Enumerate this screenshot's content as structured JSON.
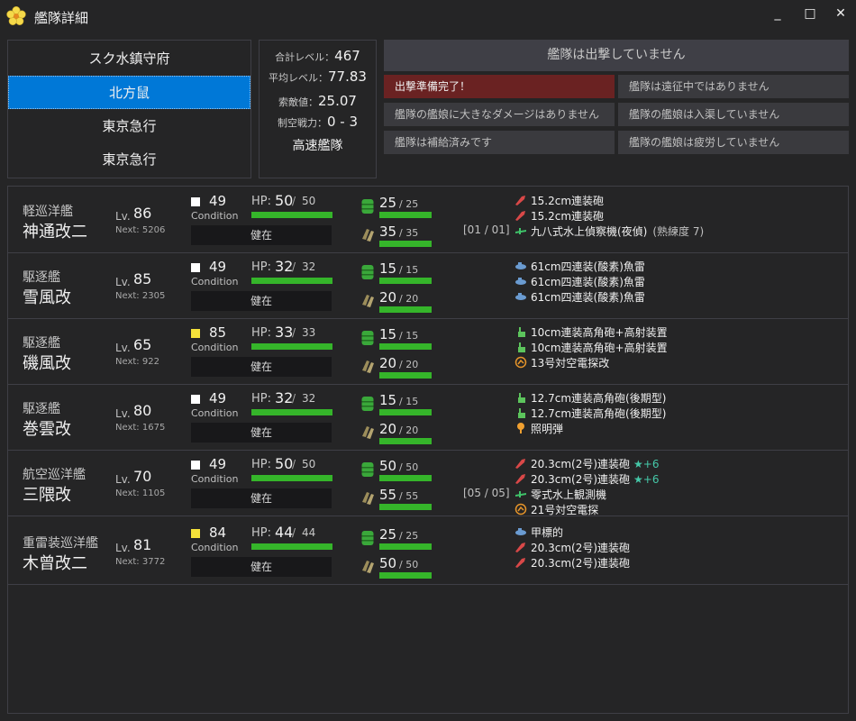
{
  "window": {
    "title": "艦隊詳細",
    "controls": [
      "_",
      "□",
      "✕"
    ]
  },
  "fleets": [
    {
      "label": "スク水鎮守府",
      "selected": false
    },
    {
      "label": "北方鼠",
      "selected": true
    },
    {
      "label": "東京急行",
      "selected": false
    },
    {
      "label": "東京急行",
      "selected": false
    }
  ],
  "fleet_stats": {
    "total_level_label": "合計レベル：",
    "total_level": "467",
    "avg_level_label": "平均レベル：",
    "avg_level": "77.83",
    "los_label": "索敵値：",
    "los": "25.07",
    "air_label": "制空戦力：",
    "air": "0 - 3",
    "speed": "高速艦隊"
  },
  "status": {
    "main": "艦隊は出撃していません",
    "cells": [
      {
        "text": "出撃準備完了！",
        "ready": true
      },
      {
        "text": "艦隊は遠征中ではありません",
        "ready": false
      },
      {
        "text": "艦隊の艦娘に大きなダメージはありません",
        "ready": false
      },
      {
        "text": "艦隊の艦娘は入渠していません",
        "ready": false
      },
      {
        "text": "艦隊は補給済みです",
        "ready": false
      },
      {
        "text": "艦隊の艦娘は疲労していません",
        "ready": false
      }
    ]
  },
  "ships": [
    {
      "type": "軽巡洋艦",
      "name": "神通改二",
      "level": "86",
      "next": "5206",
      "condition": "49",
      "condition_high": false,
      "hp": "50",
      "hp_max": "50",
      "fuel": "25",
      "fuel_max": "25",
      "ammo": "35",
      "ammo_max": "35",
      "health": "健在",
      "slot_count": "[01 / 01]",
      "equipment": [
        {
          "icon": "main-gun-icon",
          "name": "15.2cm連装砲",
          "star": "",
          "prof": ""
        },
        {
          "icon": "main-gun-icon",
          "name": "15.2cm連装砲",
          "star": "",
          "prof": ""
        },
        {
          "icon": "seaplane-icon",
          "name": "九八式水上偵察機(夜偵)",
          "star": "",
          "prof": "(熟練度 7)"
        }
      ]
    },
    {
      "type": "駆逐艦",
      "name": "雪風改",
      "level": "85",
      "next": "2305",
      "condition": "49",
      "condition_high": false,
      "hp": "32",
      "hp_max": "32",
      "fuel": "15",
      "fuel_max": "15",
      "ammo": "20",
      "ammo_max": "20",
      "health": "健在",
      "slot_count": "",
      "equipment": [
        {
          "icon": "torpedo-icon",
          "name": "61cm四連装(酸素)魚雷",
          "star": "",
          "prof": ""
        },
        {
          "icon": "torpedo-icon",
          "name": "61cm四連装(酸素)魚雷",
          "star": "",
          "prof": ""
        },
        {
          "icon": "torpedo-icon",
          "name": "61cm四連装(酸素)魚雷",
          "star": "",
          "prof": ""
        }
      ]
    },
    {
      "type": "駆逐艦",
      "name": "磯風改",
      "level": "65",
      "next": "922",
      "condition": "85",
      "condition_high": true,
      "hp": "33",
      "hp_max": "33",
      "fuel": "15",
      "fuel_max": "15",
      "ammo": "20",
      "ammo_max": "20",
      "health": "健在",
      "slot_count": "",
      "equipment": [
        {
          "icon": "secondary-gun-icon",
          "name": "10cm連装高角砲+高射装置",
          "star": "",
          "prof": ""
        },
        {
          "icon": "secondary-gun-icon",
          "name": "10cm連装高角砲+高射装置",
          "star": "",
          "prof": ""
        },
        {
          "icon": "radar-icon",
          "name": "13号対空電探改",
          "star": "",
          "prof": ""
        }
      ]
    },
    {
      "type": "駆逐艦",
      "name": "巻雲改",
      "level": "80",
      "next": "1675",
      "condition": "49",
      "condition_high": false,
      "hp": "32",
      "hp_max": "32",
      "fuel": "15",
      "fuel_max": "15",
      "ammo": "20",
      "ammo_max": "20",
      "health": "健在",
      "slot_count": "",
      "equipment": [
        {
          "icon": "secondary-gun-icon",
          "name": "12.7cm連装高角砲(後期型)",
          "star": "",
          "prof": ""
        },
        {
          "icon": "secondary-gun-icon",
          "name": "12.7cm連装高角砲(後期型)",
          "star": "",
          "prof": ""
        },
        {
          "icon": "flare-icon",
          "name": "照明弾",
          "star": "",
          "prof": ""
        }
      ]
    },
    {
      "type": "航空巡洋艦",
      "name": "三隈改",
      "level": "70",
      "next": "1105",
      "condition": "49",
      "condition_high": false,
      "hp": "50",
      "hp_max": "50",
      "fuel": "50",
      "fuel_max": "50",
      "ammo": "55",
      "ammo_max": "55",
      "health": "健在",
      "slot_count": "[05 / 05]",
      "equipment": [
        {
          "icon": "main-gun-icon",
          "name": "20.3cm(2号)連装砲",
          "star": "★+6",
          "prof": ""
        },
        {
          "icon": "main-gun-icon",
          "name": "20.3cm(2号)連装砲",
          "star": "★+6",
          "prof": ""
        },
        {
          "icon": "seaplane-icon",
          "name": "零式水上観測機",
          "star": "",
          "prof": ""
        },
        {
          "icon": "radar-icon",
          "name": "21号対空電探",
          "star": "",
          "prof": ""
        }
      ]
    },
    {
      "type": "重雷装巡洋艦",
      "name": "木曾改二",
      "level": "81",
      "next": "3772",
      "condition": "84",
      "condition_high": true,
      "hp": "44",
      "hp_max": "44",
      "fuel": "25",
      "fuel_max": "25",
      "ammo": "50",
      "ammo_max": "50",
      "health": "健在",
      "slot_count": "",
      "equipment": [
        {
          "icon": "torpedo-icon",
          "name": "甲標的",
          "star": "",
          "prof": ""
        },
        {
          "icon": "main-gun-icon",
          "name": "20.3cm(2号)連装砲",
          "star": "",
          "prof": ""
        },
        {
          "icon": "main-gun-icon",
          "name": "20.3cm(2号)連装砲",
          "star": "",
          "prof": ""
        }
      ]
    }
  ],
  "labels": {
    "lv": "Lv.",
    "next": "Next:",
    "condition": "Condition",
    "hp": "HP:",
    "slash": "/"
  },
  "colors": {
    "accent": "#0078d7",
    "bar": "#35b52a",
    "ready": "#6a2222",
    "cond_high": "#f5e23a",
    "star": "#45c8a8"
  }
}
